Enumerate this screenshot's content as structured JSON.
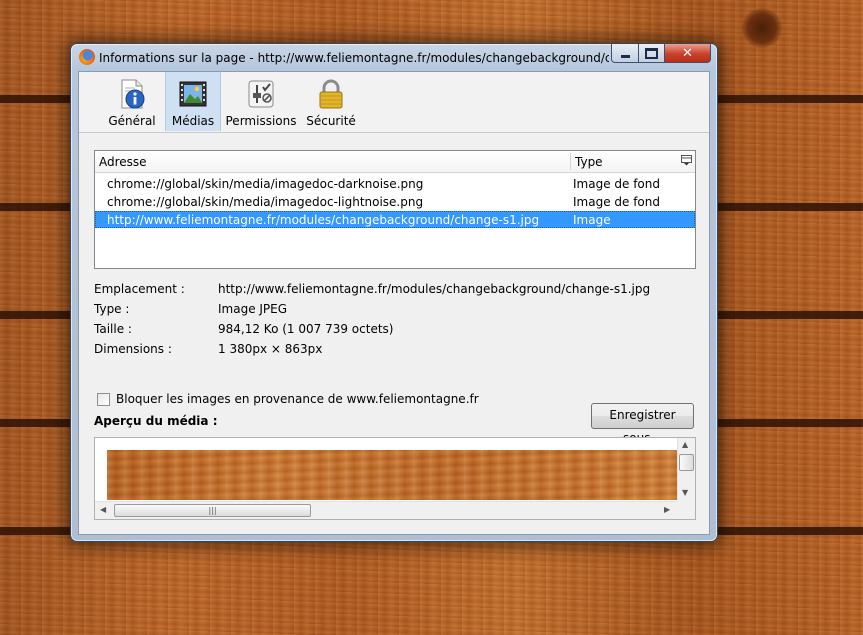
{
  "window": {
    "title": "Informations sur la page - http://www.feliemontagne.fr/modules/changebackground/change-..."
  },
  "toolbar": {
    "tabs": [
      {
        "label": "Général",
        "icon": "info-icon",
        "selected": false
      },
      {
        "label": "Médias",
        "icon": "media-icon",
        "selected": true
      },
      {
        "label": "Permissions",
        "icon": "permissions-icon",
        "selected": false
      },
      {
        "label": "Sécurité",
        "icon": "lock-icon",
        "selected": false
      }
    ]
  },
  "media_list": {
    "columns": [
      "Adresse",
      "Type"
    ],
    "rows": [
      {
        "address": "chrome://global/skin/media/imagedoc-darknoise.png",
        "type": "Image de fond",
        "selected": false
      },
      {
        "address": "chrome://global/skin/media/imagedoc-lightnoise.png",
        "type": "Image de fond",
        "selected": false
      },
      {
        "address": "http://www.feliemontagne.fr/modules/changebackground/change-s1.jpg",
        "type": "Image",
        "selected": true
      }
    ]
  },
  "details": [
    {
      "key": "Emplacement :",
      "value": "http://www.feliemontagne.fr/modules/changebackground/change-s1.jpg"
    },
    {
      "key": "Type :",
      "value": "Image JPEG"
    },
    {
      "key": "Taille :",
      "value": "984,12 Ko (1 007 739 octets)"
    },
    {
      "key": "Dimensions :",
      "value": "1 380px × 863px"
    }
  ],
  "block_checkbox": {
    "label": "Bloquer les images en provenance de www.feliemontagne.fr",
    "checked": false
  },
  "save_button": {
    "label": "Enregistrer sous..."
  },
  "preview": {
    "label": "Aperçu du média :"
  },
  "colors": {
    "selection": "#3399ff",
    "close_button": "#c9422c"
  }
}
